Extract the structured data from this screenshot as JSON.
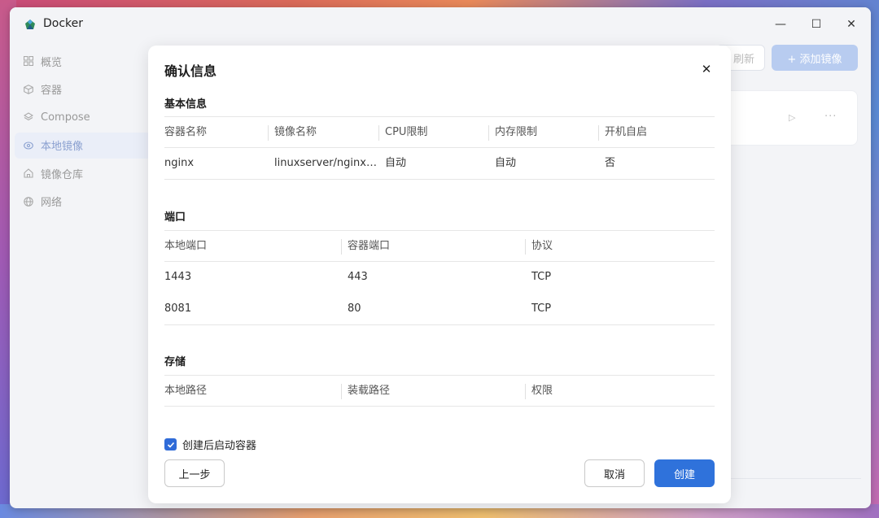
{
  "window": {
    "title": "Docker",
    "minimize": "—",
    "maximize": "☐",
    "close": "✕"
  },
  "sidebar": {
    "items": [
      {
        "label": "概览",
        "icon": "grid-icon"
      },
      {
        "label": "容器",
        "icon": "cube-icon"
      },
      {
        "label": "Compose",
        "icon": "layers-icon"
      },
      {
        "label": "本地镜像",
        "icon": "disc-icon",
        "active": true
      },
      {
        "label": "镜像仓库",
        "icon": "home-icon"
      },
      {
        "label": "网络",
        "icon": "globe-icon"
      }
    ]
  },
  "toolbar": {
    "refresh_label": "刷新",
    "add_image_label": "+ 添加镜像"
  },
  "card": {
    "play": "▷",
    "more": "···"
  },
  "dialog": {
    "title": "确认信息",
    "close": "✕",
    "basic": {
      "title": "基本信息",
      "headers": [
        "容器名称",
        "镜像名称",
        "CPU限制",
        "内存限制",
        "开机自启"
      ],
      "row": [
        "nginx",
        "linuxserver/nginx:la...",
        "自动",
        "自动",
        "否"
      ]
    },
    "ports": {
      "title": "端口",
      "headers": [
        "本地端口",
        "容器端口",
        "协议"
      ],
      "rows": [
        [
          "1443",
          "443",
          "TCP"
        ],
        [
          "8081",
          "80",
          "TCP"
        ]
      ]
    },
    "storage": {
      "title": "存储",
      "headers": [
        "本地路径",
        "装载路径",
        "权限"
      ]
    },
    "start_after_create": {
      "label": "创建后启动容器",
      "checked": true
    },
    "buttons": {
      "prev": "上一步",
      "cancel": "取消",
      "create": "创建"
    }
  },
  "colors": {
    "primary": "#2f72db",
    "accent_disabled": "#b8ccf0"
  }
}
